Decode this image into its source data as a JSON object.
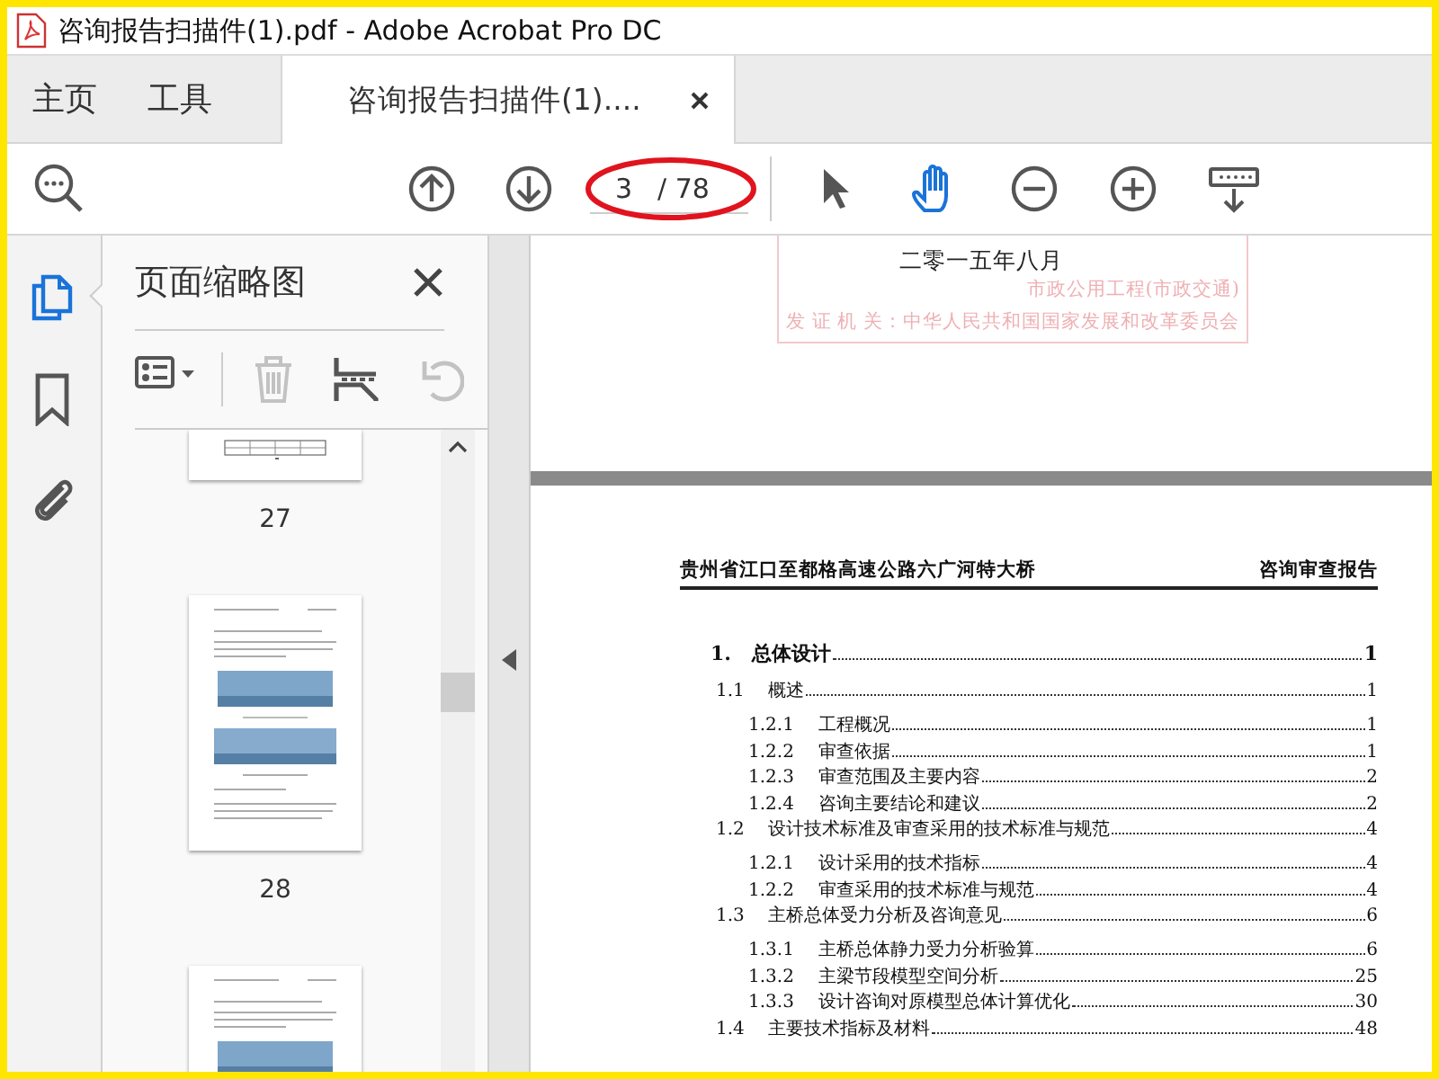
{
  "window": {
    "title": "咨询报告扫描件(1).pdf - Adobe Acrobat Pro DC"
  },
  "tabs": [
    {
      "label": "主页",
      "selected": false
    },
    {
      "label": "工具",
      "selected": false
    },
    {
      "label": "咨询报告扫描件(1)....",
      "selected": true
    }
  ],
  "toolbar": {
    "page_number": "3",
    "page_count": "/ 78",
    "circled": true,
    "tools": [
      {
        "kind": "select",
        "selected": false
      },
      {
        "kind": "hand",
        "selected": true
      },
      {
        "kind": "zoom_out",
        "selected": false
      },
      {
        "kind": "zoom_in",
        "selected": false
      }
    ]
  },
  "left_rail": [
    {
      "kind": "thumbnails",
      "selected": true
    },
    {
      "kind": "bookmarks",
      "selected": false
    },
    {
      "kind": "attachments",
      "selected": false
    }
  ],
  "thumbnail_panel": {
    "title": "页面缩略图",
    "tools": [
      {
        "kind": "options",
        "disabled": false
      },
      {
        "kind": "delete",
        "disabled": true
      },
      {
        "kind": "extract",
        "disabled": false
      },
      {
        "kind": "rotate",
        "disabled": true
      }
    ],
    "pages": [
      {
        "kind": "table",
        "label": "27"
      },
      {
        "kind": "figures",
        "label": "28"
      },
      {
        "kind": "figures"
      }
    ]
  },
  "document": {
    "date": "二零一五年八月",
    "stamp_lines": [
      "市政公用工程(市政交通)",
      "发 证 机 关：中华人民共和国国家发展和改革委员会"
    ],
    "header_left": "贵州省江口至都格高速公路六广河特大桥",
    "header_right": "咨询审查报告",
    "toc": [
      {
        "number": "1.",
        "title": "总体设计",
        "page": "1",
        "children": [
          {
            "number": "1.1",
            "title": "概述",
            "page": "1",
            "children": [
              {
                "number": "1.2.1",
                "title": "工程概况",
                "page": "1"
              },
              {
                "number": "1.2.2",
                "title": "审查依据",
                "page": "1"
              },
              {
                "number": "1.2.3",
                "title": "审查范围及主要内容",
                "page": "2"
              },
              {
                "number": "1.2.4",
                "title": "咨询主要结论和建议",
                "page": "2"
              }
            ]
          },
          {
            "number": "1.2",
            "title": "设计技术标准及审查采用的技术标准与规范",
            "page": "4",
            "children": [
              {
                "number": "1.2.1",
                "title": "设计采用的技术指标",
                "page": "4"
              },
              {
                "number": "1.2.2",
                "title": "审查采用的技术标准与规范",
                "page": "4"
              }
            ]
          },
          {
            "number": "1.3",
            "title": "主桥总体受力分析及咨询意见",
            "page": "6",
            "children": [
              {
                "number": "1.3.1",
                "title": "主桥总体静力受力分析验算",
                "page": "6"
              },
              {
                "number": "1.3.2",
                "title": "主梁节段模型空间分析",
                "page": "25"
              },
              {
                "number": "1.3.3",
                "title": "设计咨询对原模型总体计算优化",
                "page": "30"
              }
            ]
          },
          {
            "number": "1.4",
            "title": "主要技术指标及材料",
            "page": "48"
          }
        ]
      }
    ]
  }
}
